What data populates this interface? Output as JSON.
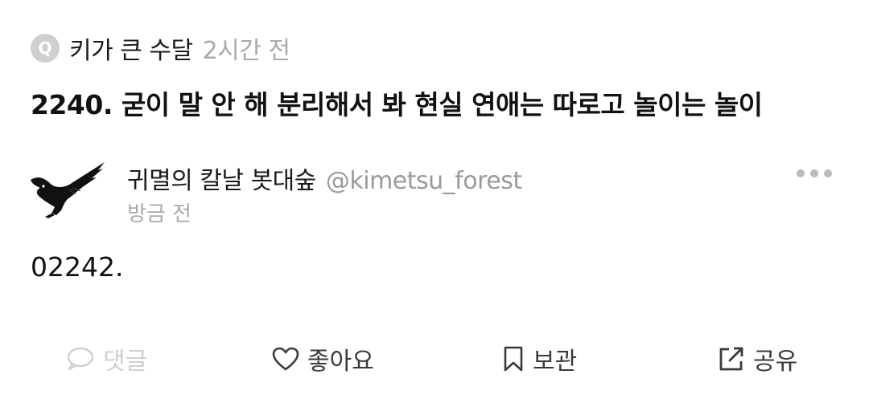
{
  "question_header": {
    "badge": "Q",
    "author": "키가 큰 수달",
    "time": "2시간 전"
  },
  "question": {
    "text": "2240. 굳이 말 안 해 분리해서 봐 현실 연애는 따로고 놀이는 놀이"
  },
  "answer_post": {
    "avatar_icon": "crow-avatar-icon",
    "display_name": "귀멸의 칼날 봇대숲",
    "handle": "@kimetsu_forest",
    "time": "방금 전",
    "more_icon": "more-dots-icon",
    "body": "02242."
  },
  "actions": {
    "comment": {
      "label": "댓글",
      "icon": "comment-bubble-icon",
      "color": "#cfcfcf"
    },
    "like": {
      "label": "좋아요",
      "icon": "heart-icon",
      "color": "#3a3a3a"
    },
    "save": {
      "label": "보관",
      "icon": "bookmark-icon",
      "color": "#3a3a3a"
    },
    "share": {
      "label": "공유",
      "icon": "share-icon",
      "color": "#3a3a3a"
    }
  }
}
